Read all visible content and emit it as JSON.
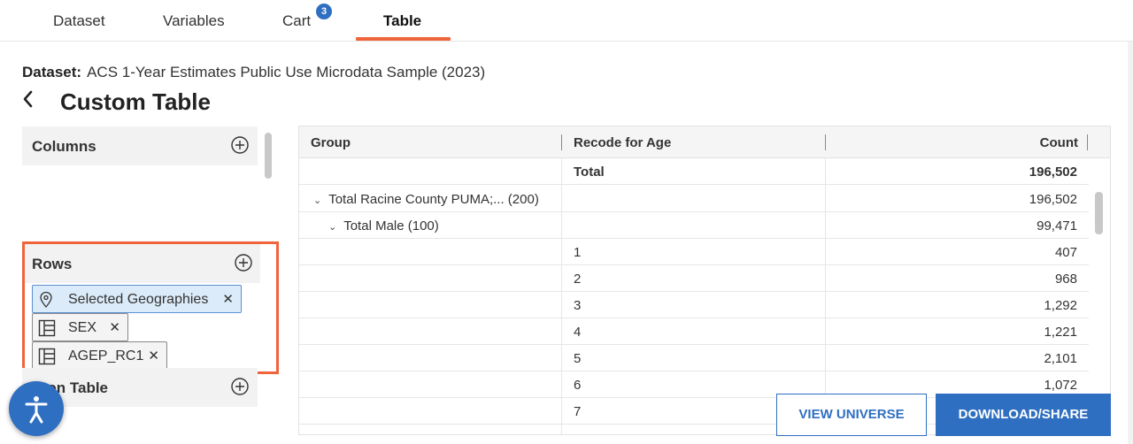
{
  "tabs": [
    {
      "label": "Dataset",
      "active": false
    },
    {
      "label": "Variables",
      "active": false
    },
    {
      "label": "Cart",
      "active": false,
      "badge": "3"
    },
    {
      "label": "Table",
      "active": true
    }
  ],
  "dataset": {
    "label": "Dataset:",
    "value": "ACS 1-Year Estimates Public Use Microdata Sample (2023)"
  },
  "page": {
    "title": "Custom Table"
  },
  "panel": {
    "columns": {
      "title": "Columns"
    },
    "rows": {
      "title": "Rows",
      "chips": [
        {
          "label": "Selected Geographies",
          "icon": "location-pin-icon"
        },
        {
          "label": "SEX",
          "icon": "table-variable-icon"
        },
        {
          "label": "AGEP_RC1",
          "icon": "table-variable-icon"
        }
      ]
    },
    "filters": {
      "title": "t on Table"
    }
  },
  "table": {
    "headers": [
      "Group",
      "Recode for Age",
      "Count"
    ],
    "total_row": {
      "group": "",
      "recode": "Total",
      "count": "196,502"
    },
    "rows": [
      {
        "group": "Total Racine County PUMA;... (200)",
        "recode": "",
        "count": "196,502",
        "level": 0
      },
      {
        "group": "Total Male (100)",
        "recode": "",
        "count": "99,471",
        "level": 1
      },
      {
        "group": "",
        "recode": "1",
        "count": "407",
        "level": 2
      },
      {
        "group": "",
        "recode": "2",
        "count": "968",
        "level": 2
      },
      {
        "group": "",
        "recode": "3",
        "count": "1,292",
        "level": 2
      },
      {
        "group": "",
        "recode": "4",
        "count": "1,221",
        "level": 2
      },
      {
        "group": "",
        "recode": "5",
        "count": "2,101",
        "level": 2
      },
      {
        "group": "",
        "recode": "6",
        "count": "1,072",
        "level": 2
      },
      {
        "group": "",
        "recode": "7",
        "count": "",
        "level": 2
      }
    ]
  },
  "buttons": {
    "view_universe": "VIEW UNIVERSE",
    "download_share": "DOWNLOAD/SHARE"
  },
  "colors": {
    "accent": "#f0643c",
    "primary": "#2f6fc1"
  }
}
